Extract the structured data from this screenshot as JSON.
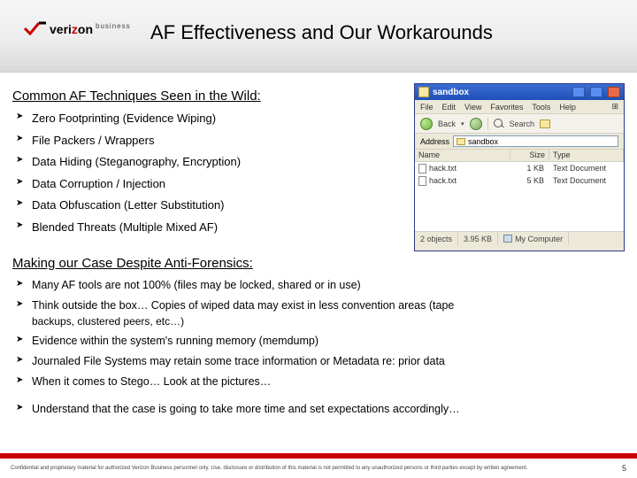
{
  "header": {
    "logo": {
      "brand_part1": "veri",
      "brand_part2": "z",
      "brand_part3": "on",
      "sub": "business"
    },
    "title": "AF Effectiveness and Our Workarounds"
  },
  "section1": {
    "heading": "Common AF Techniques Seen in the Wild:",
    "items": [
      "Zero Footprinting (Evidence Wiping)",
      "File Packers / Wrappers",
      "Data Hiding (Steganography, Encryption)",
      "Data Corruption / Injection",
      "Data Obfuscation (Letter Substitution)",
      "Blended Threats (Multiple Mixed AF)"
    ]
  },
  "section2": {
    "heading": "Making our Case Despite Anti-Forensics:",
    "items": [
      {
        "text": "Many AF tools are not 100% (files may be locked, shared or in use)"
      },
      {
        "text": "Think outside the box… Copies of wiped data may exist in less convention areas (tape",
        "sub": "backups, clustered peers, etc…)"
      },
      {
        "text": "Evidence within the system's running memory (memdump)"
      },
      {
        "text": "Journaled File Systems may retain some trace information or Metadata re: prior data"
      },
      {
        "text": "When it comes to Stego… Look at the pictures…"
      },
      {
        "text": "Understand that the case is going to take more time and set expectations accordingly…",
        "gap": true
      }
    ]
  },
  "screenshot": {
    "title": "sandbox",
    "menu": [
      "File",
      "Edit",
      "View",
      "Favorites",
      "Tools",
      "Help"
    ],
    "menu_logo_glyph": "⊞",
    "toolbar": {
      "back": "Back",
      "search": "Search"
    },
    "address": {
      "label": "Address",
      "value": "sandbox"
    },
    "columns": [
      "Name",
      "Size",
      "Type"
    ],
    "rows": [
      {
        "name": "hack.txt",
        "size": "1 KB",
        "type": "Text Document"
      },
      {
        "name": "hack.txt",
        "size": "5 KB",
        "type": "Text Document"
      }
    ],
    "status": {
      "objects": "2 objects",
      "bytes": "3.95 KB",
      "location": "My Computer"
    }
  },
  "footer": {
    "disclaimer": "Confidential and proprietary material for authorized Verizon Business personnel only. Use, disclosure or distribution of this material is not permitted to any unauthorized persons or third parties except by written agreement.",
    "page": "5"
  }
}
